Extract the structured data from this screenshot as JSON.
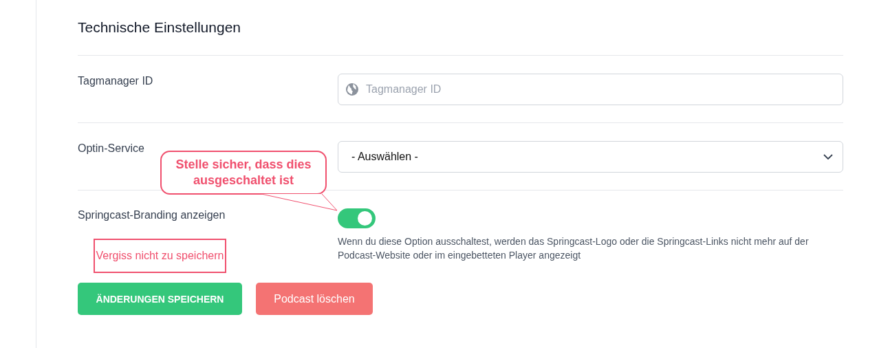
{
  "section_title": "Technische Einstellungen",
  "settings": [
    {
      "kind": "text",
      "label": "Tagmanager ID",
      "placeholder": "Tagmanager ID"
    },
    {
      "kind": "select",
      "label": "Optin-Service",
      "value": "- Auswählen -"
    },
    {
      "kind": "toggle",
      "label": "Springcast-Branding anzeigen",
      "on": true,
      "help": "Wenn du diese Option ausschaltest, werden das Springcast-Logo oder die Springcast-Links nicht mehr auf der Podcast-Website oder im eingebetteten Player angezeigt"
    }
  ],
  "annotations": [
    {
      "kind": "callout",
      "text": "Stelle sicher, dass dies ausgeschaltet ist"
    },
    {
      "kind": "note",
      "text": "Vergiss nicht zu speichern"
    }
  ],
  "buttons": [
    {
      "kind": "primary",
      "label": "ÄNDERUNGEN SPEICHERN"
    },
    {
      "kind": "danger",
      "label": "Podcast löschen"
    }
  ]
}
